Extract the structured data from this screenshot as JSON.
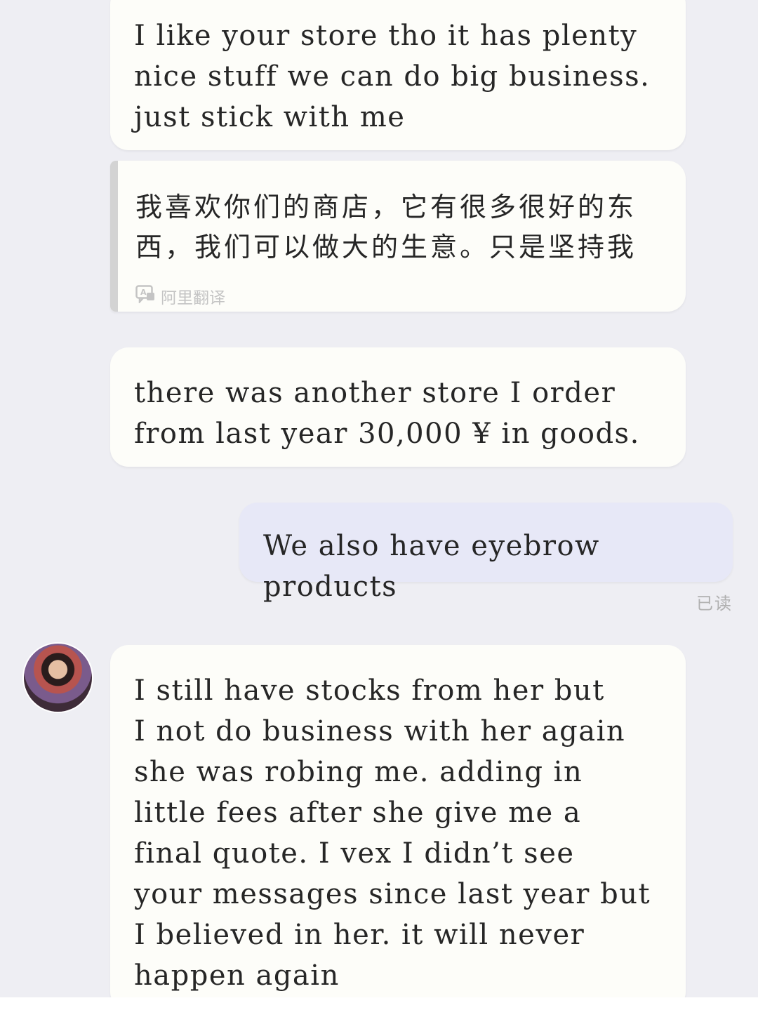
{
  "messages": [
    {
      "id": "incoming-1",
      "direction": "incoming",
      "text": "I like your store tho it has plenty\nnice stuff we can do big business.\njust stick with me"
    },
    {
      "id": "translation-1",
      "direction": "incoming",
      "text": "我喜欢你们的商店，它有很多很好的东\n西，我们可以做大的生意。只是坚持我",
      "translation_label": "阿里翻译",
      "translation_icon": "translate-icon"
    },
    {
      "id": "incoming-2",
      "direction": "incoming",
      "text": "there was another store I order\nfrom last year 30,000 ¥ in goods."
    },
    {
      "id": "outgoing-1",
      "direction": "outgoing",
      "text": "We also have eyebrow products",
      "status": "已读"
    },
    {
      "id": "incoming-3",
      "direction": "incoming",
      "text": "I still have stocks from her but\nI not do business with her again\nshe was robing me. adding in\nlittle fees after she give me a\nfinal quote. I vex I didn’t see\nyour messages since last year but\nI believed in her. it will never\nhappen again"
    }
  ],
  "colors": {
    "background": "#eeeef3",
    "incoming_bubble": "#fdfdf9",
    "outgoing_bubble": "#e7e8f7",
    "text": "#262626",
    "muted": "#b0b0b0"
  }
}
